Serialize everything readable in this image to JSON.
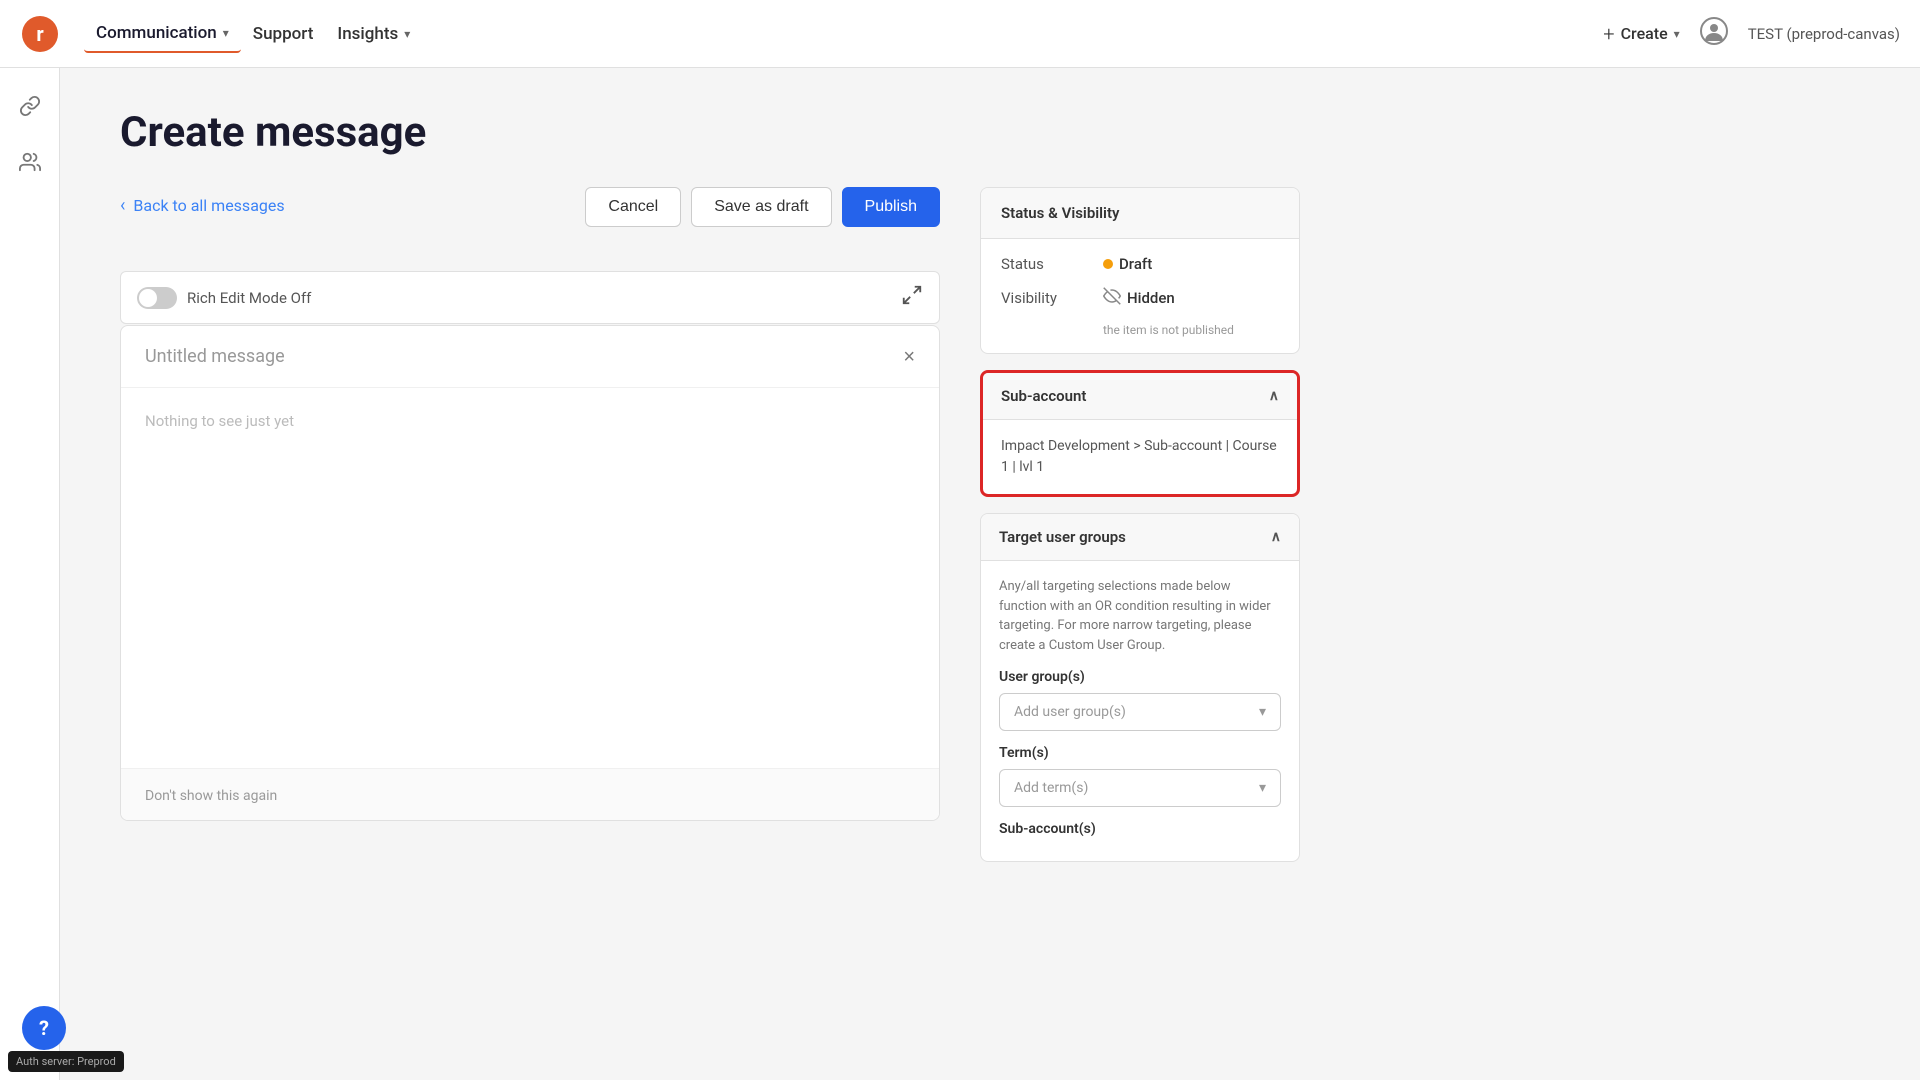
{
  "navbar": {
    "logo_label": "Raptor Logo",
    "nav_items": [
      {
        "label": "Communication",
        "active": true,
        "has_dropdown": true
      },
      {
        "label": "Support",
        "active": false,
        "has_dropdown": false
      },
      {
        "label": "Insights",
        "active": false,
        "has_dropdown": true
      }
    ],
    "create_label": "Create",
    "env_label": "TEST (preprod-canvas)"
  },
  "sidebar_left": {
    "icons": [
      {
        "name": "link-icon",
        "symbol": "🔗"
      },
      {
        "name": "users-icon",
        "symbol": "👥"
      }
    ]
  },
  "page": {
    "title": "Create message"
  },
  "back_link": {
    "label": "Back to all messages"
  },
  "action_buttons": {
    "cancel_label": "Cancel",
    "save_draft_label": "Save as draft",
    "publish_label": "Publish"
  },
  "editor": {
    "rich_edit_label": "Rich Edit Mode Off",
    "expand_icon": "⤢"
  },
  "message_card": {
    "title": "Untitled message",
    "close_symbol": "×",
    "body_placeholder": "Nothing to see just yet",
    "footer_label": "Don't show this again"
  },
  "status_visibility": {
    "panel_title": "Status & Visibility",
    "status_label": "Status",
    "status_value": "Draft",
    "visibility_label": "Visibility",
    "visibility_value": "Hidden",
    "visibility_sub": "the item is not published"
  },
  "subaccount": {
    "panel_title": "Sub-account",
    "chevron": "^",
    "content": "Impact Development > Sub-account | Course 1 | lvl 1"
  },
  "target_user_groups": {
    "panel_title": "Target user groups",
    "chevron": "^",
    "description": "Any/all targeting selections made below function with an OR condition resulting in wider targeting. For more narrow targeting, please create a Custom User Group.",
    "user_groups_label": "User group(s)",
    "user_groups_placeholder": "Add user group(s)",
    "terms_label": "Term(s)",
    "terms_placeholder": "Add term(s)",
    "subaccounts_label": "Sub-account(s)"
  },
  "help": {
    "symbol": "?"
  },
  "auth_badge": {
    "label": "Auth server: Preprod"
  }
}
